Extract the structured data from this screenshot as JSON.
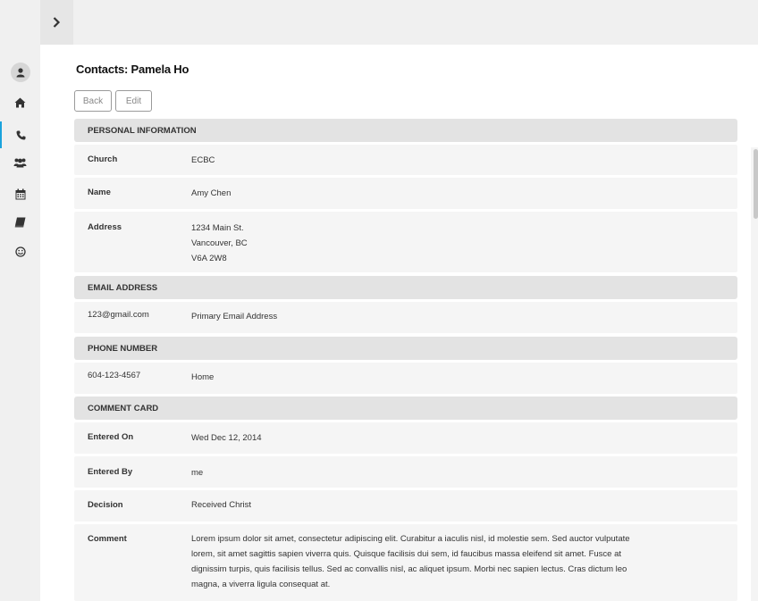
{
  "page": {
    "title": "Contacts: Pamela Ho"
  },
  "toolbar": {
    "back_label": "Back",
    "edit_label": "Edit"
  },
  "sidebar": {
    "items": [
      {
        "icon": "user-icon"
      },
      {
        "icon": "home-icon"
      },
      {
        "icon": "phone-icon",
        "active": true
      },
      {
        "icon": "group-icon"
      },
      {
        "icon": "calendar-icon"
      },
      {
        "icon": "book-icon"
      },
      {
        "icon": "smiley-icon"
      }
    ]
  },
  "personal": {
    "header": "PERSONAL INFORMATION",
    "church_label": "Church",
    "church_value": "ECBC",
    "name_label": "Name",
    "name_value": "Amy Chen",
    "address_label": "Address",
    "address_line1": "1234 Main St.",
    "address_line2": "Vancouver, BC",
    "address_line3": "V6A 2W8"
  },
  "email": {
    "header": "EMAIL ADDRESS",
    "address": "123@gmail.com",
    "type": "Primary Email Address"
  },
  "phone": {
    "header": "PHONE NUMBER",
    "number": "604-123-4567",
    "type": "Home"
  },
  "comment_card": {
    "header": "COMMENT CARD",
    "entered_on_label": "Entered On",
    "entered_on_value": "Wed Dec 12, 2014",
    "entered_by_label": "Entered By",
    "entered_by_value": "me",
    "decision_label": "Decision",
    "decision_value": "Received Christ",
    "comment_label": "Comment",
    "comment_line1": "Lorem ipsum dolor sit amet, consectetur adipiscing elit. Curabitur a iaculis nisl, id molestie sem. Sed auctor vulputate",
    "comment_line2": "lorem, sit amet sagittis sapien viverra quis. Quisque facilisis dui sem, id faucibus massa eleifend sit amet. Fusce at",
    "comment_line3": "dignissim turpis, quis facilisis tellus. Sed ac convallis nisl, ac aliquet ipsum. Morbi nec sapien lectus. Cras dictum leo",
    "comment_line4": "magna, a viverra ligula consequat at."
  },
  "colors": {
    "accent": "#1aa3dc",
    "sidebar_bg": "#f0f0f0",
    "section_bg": "#e3e3e3",
    "row_bg": "#f5f5f5"
  }
}
